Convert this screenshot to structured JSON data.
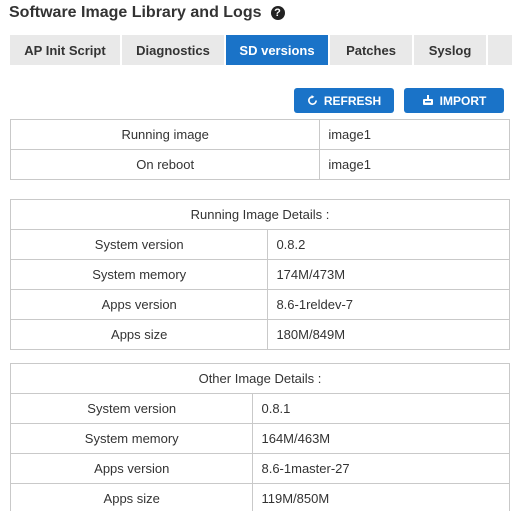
{
  "header": {
    "title": "Software Image Library and Logs",
    "help_symbol": "?"
  },
  "tabs": [
    {
      "label": "AP Init Script",
      "active": false
    },
    {
      "label": "Diagnostics",
      "active": false
    },
    {
      "label": "SD versions",
      "active": true
    },
    {
      "label": "Patches",
      "active": false
    },
    {
      "label": "Syslog",
      "active": false
    },
    {
      "label": "C",
      "active": false
    }
  ],
  "actions": {
    "refresh_label": "REFRESH",
    "refresh_icon": "refresh-icon",
    "import_label": "IMPORT",
    "import_icon": "import-icon"
  },
  "image_table": {
    "rows": [
      {
        "label": "Running image",
        "value": "image1"
      },
      {
        "label": "On reboot",
        "value": "image1"
      }
    ]
  },
  "running_details": {
    "heading": "Running Image Details :",
    "rows": [
      {
        "label": "System version",
        "value": "0.8.2"
      },
      {
        "label": "System memory",
        "value": "174M/473M"
      },
      {
        "label": "Apps version",
        "value": "8.6-1reldev-7"
      },
      {
        "label": "Apps size",
        "value": "180M/849M"
      }
    ]
  },
  "other_details": {
    "heading": "Other Image Details :",
    "rows": [
      {
        "label": "System version",
        "value": "0.8.1"
      },
      {
        "label": "System memory",
        "value": "164M/463M"
      },
      {
        "label": "Apps version",
        "value": "8.6-1master-27"
      },
      {
        "label": "Apps size",
        "value": "119M/850M"
      }
    ]
  },
  "colors": {
    "accent": "#1a73c8",
    "tab_inactive": "#e9e9e9",
    "border": "#c9c9c9"
  }
}
